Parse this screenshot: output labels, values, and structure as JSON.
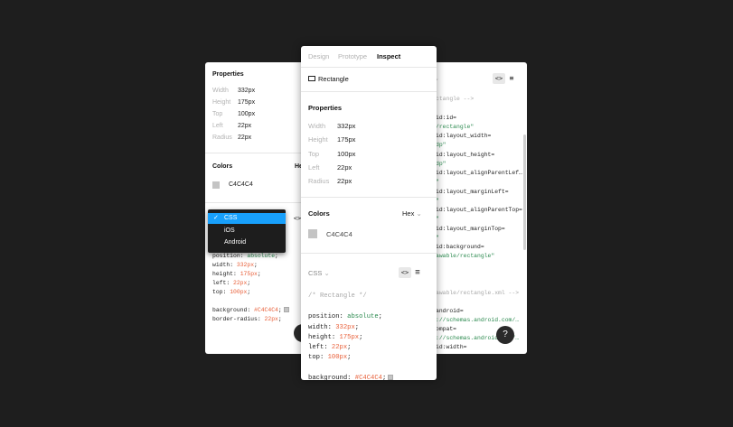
{
  "tabs": [
    {
      "label": "Design"
    },
    {
      "label": "Prototype"
    },
    {
      "label": "Inspect"
    }
  ],
  "layer": {
    "name": "Rectangle"
  },
  "properties": {
    "title": "Properties",
    "items": [
      {
        "label": "Width",
        "value": "332px"
      },
      {
        "label": "Height",
        "value": "175px"
      },
      {
        "label": "Top",
        "value": "100px"
      },
      {
        "label": "Left",
        "value": "22px"
      },
      {
        "label": "Radius",
        "value": "22px"
      }
    ]
  },
  "colors": {
    "title": "Colors",
    "format": "Hex",
    "format_partial": "He",
    "swatch_color": "#C4C4C4",
    "swatch_label": "C4C4C4"
  },
  "code": {
    "language": "CSS",
    "comment": "/* Rectangle */",
    "lines": [
      {
        "prop": "position",
        "value": "absolute"
      },
      {
        "prop": "width",
        "value": "332px"
      },
      {
        "prop": "height",
        "value": "175px"
      },
      {
        "prop": "left",
        "value": "22px"
      },
      {
        "prop": "top",
        "value": "100px"
      },
      {
        "prop": "background",
        "value": "#C4C4C4"
      },
      {
        "prop": "border-radius",
        "value": "22px"
      }
    ]
  },
  "language_menu": {
    "options": [
      {
        "label": "CSS",
        "selected": true
      },
      {
        "label": "iOS",
        "selected": false
      },
      {
        "label": "Android",
        "selected": false
      }
    ]
  },
  "android_code": {
    "lines": [
      "ctangle -->",
      "id:id=",
      "/rectangle\"",
      "id:layout_width=",
      "dp\"",
      "id:layout_height=",
      "dp\"",
      "id:layout_alignParentLef…",
      "\"",
      "id:layout_marginLeft=",
      "\"",
      "id:layout_alignParentTop=",
      "\"",
      "id:layout_marginTop=",
      "\"",
      "id:background=",
      "awable/rectangle\"",
      "awable/rectangle.xml -->",
      "android=",
      "://schemas.android.com/…",
      "ompat=",
      "://schemas.android.com/…",
      "id:width="
    ]
  },
  "help": {
    "label": "?"
  }
}
